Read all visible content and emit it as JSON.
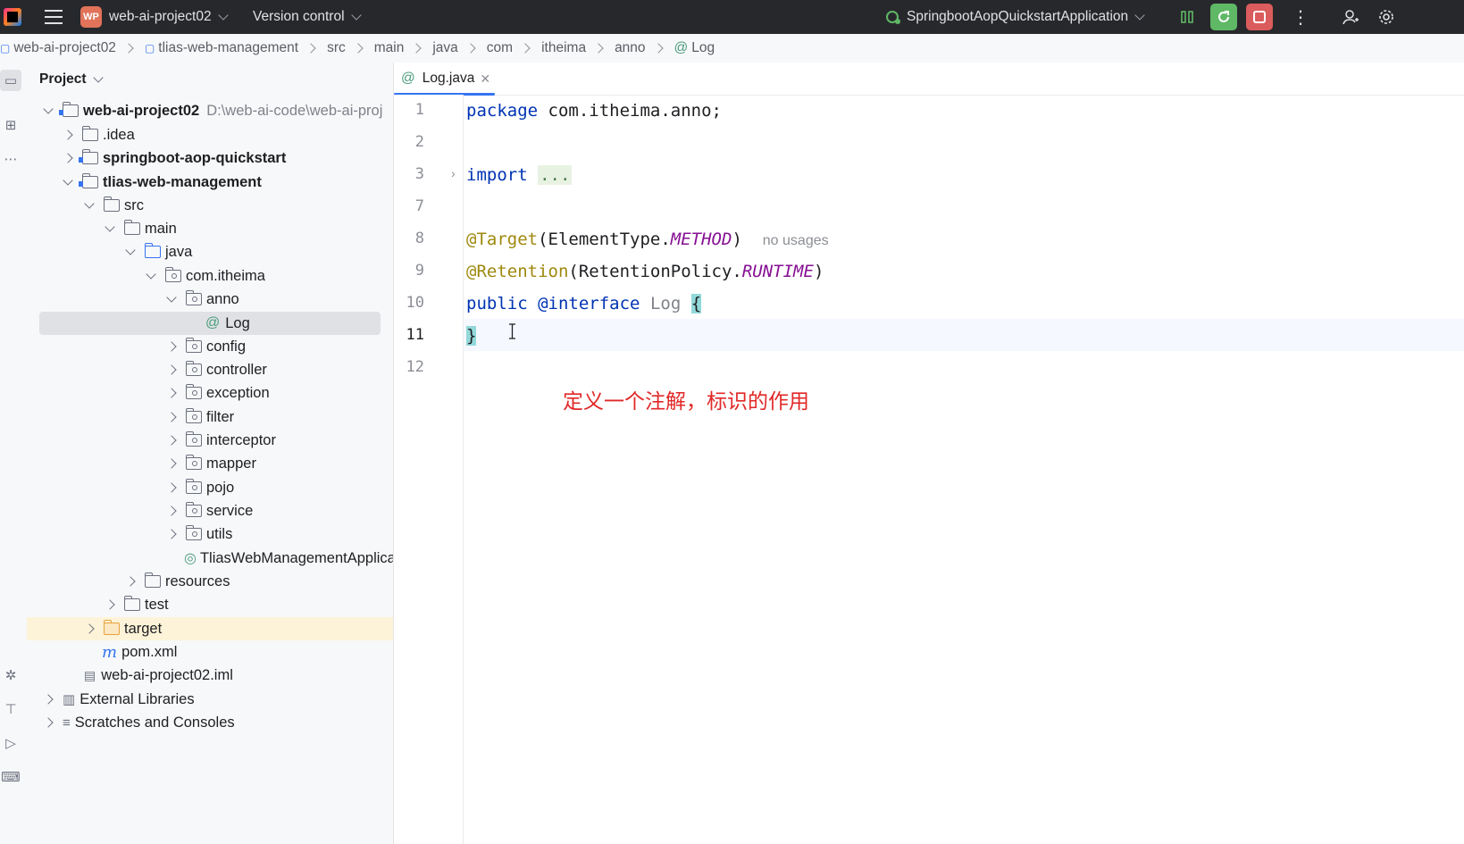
{
  "topbar": {
    "project_badge": "WP",
    "project_name": "web-ai-project02",
    "vcs": "Version control",
    "run_config": "SpringbootAopQuickstartApplication"
  },
  "breadcrumb": [
    "web-ai-project02",
    "tlias-web-management",
    "src",
    "main",
    "java",
    "com",
    "itheima",
    "anno",
    "Log"
  ],
  "panel": {
    "title": "Project",
    "tree": [
      {
        "label": "web-ai-project02",
        "path": "D:\\web-ai-code\\web-ai-proj"
      },
      {
        "label": ".idea"
      },
      {
        "label": "springboot-aop-quickstart"
      },
      {
        "label": "tlias-web-management"
      },
      {
        "label": "src"
      },
      {
        "label": "main"
      },
      {
        "label": "java"
      },
      {
        "label": "com.itheima"
      },
      {
        "label": "anno"
      },
      {
        "label": "Log"
      },
      {
        "label": "config"
      },
      {
        "label": "controller"
      },
      {
        "label": "exception"
      },
      {
        "label": "filter"
      },
      {
        "label": "interceptor"
      },
      {
        "label": "mapper"
      },
      {
        "label": "pojo"
      },
      {
        "label": "service"
      },
      {
        "label": "utils"
      },
      {
        "label": "TliasWebManagementApplica"
      },
      {
        "label": "resources"
      },
      {
        "label": "test"
      },
      {
        "label": "target"
      },
      {
        "label": "pom.xml"
      },
      {
        "label": "web-ai-project02.iml"
      },
      {
        "label": "External Libraries"
      },
      {
        "label": "Scratches and Consoles"
      }
    ]
  },
  "editor": {
    "tab_label": "Log.java",
    "line_numbers": [
      "1",
      "2",
      "3",
      "7",
      "8",
      "9",
      "10",
      "11",
      "12"
    ],
    "code": {
      "l1_kw": "package",
      "l1_rest": " com.itheima.anno;",
      "l3_kw": "import",
      "l3_fold": "...",
      "l8_ann": "@Target",
      "l8_a": "(ElementType.",
      "l8_const": "METHOD",
      "l8_b": ")",
      "l8_hint": "no usages",
      "l9_ann": "@Retention",
      "l9_a": "(RetentionPolicy.",
      "l9_const": "RUNTIME",
      "l9_b": ")",
      "l10_kw": "public",
      "l10_ann": "@interface",
      "l10_name": "Log",
      "l10_brace": "{",
      "l11_brace": "}"
    }
  },
  "annotation_note": "定义一个注解，标识的作用",
  "colors": {
    "accent": "#3574f0",
    "keyword": "#0033b3",
    "annotation": "#9e880d",
    "constant": "#871094",
    "note": "#e12828"
  }
}
